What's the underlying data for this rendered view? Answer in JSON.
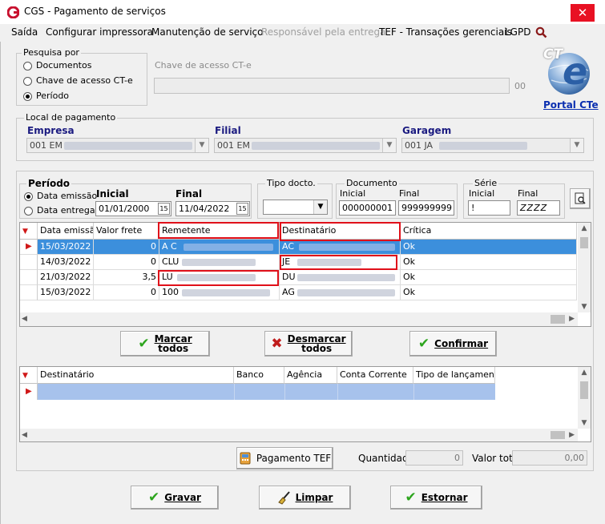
{
  "window": {
    "title": "CGS - Pagamento de serviços",
    "close": "✕"
  },
  "menu": {
    "items": [
      "Saída",
      "Configurar impressora",
      "Manutenção de serviço",
      "Responsável pela entrega",
      "TEF - Transações gerenciais",
      "LGPD"
    ],
    "disabled_item": "Responsável pela entrega"
  },
  "pesquisa": {
    "legend": "Pesquisa por",
    "options": [
      "Documentos",
      "Chave de acesso CT-e",
      "Período"
    ],
    "selected": "Período"
  },
  "chave": {
    "label": "Chave de acesso CT-e",
    "value": "",
    "suffix": "00"
  },
  "logo": {
    "text": "CT",
    "letter": "e",
    "link": "Portal CTe"
  },
  "local": {
    "legend": "Local de pagamento",
    "empresa_label": "Empresa",
    "empresa_value": "001 EM",
    "filial_label": "Filial",
    "filial_value": "001 EM",
    "garagem_label": "Garagem",
    "garagem_value": "001 JA"
  },
  "filters": {
    "periodo_legend": "Período",
    "periodo_options": [
      "Data emissão",
      "Data entrega"
    ],
    "periodo_selected": "Data emissão",
    "inicial_label": "Inicial",
    "inicial_value": "01/01/2000",
    "final_label": "Final",
    "final_value": "11/04/2022",
    "calendar_icon": "15",
    "tipo_legend": "Tipo docto.",
    "tipo_value": "",
    "documento_legend": "Documento",
    "doc_inicial_label": "Inicial",
    "doc_inicial_value": "000000001",
    "doc_final_label": "Final",
    "doc_final_value": "999999999",
    "serie_legend": "Série",
    "serie_inicial_label": "Inicial",
    "serie_inicial_value": "!",
    "serie_final_label": "Final",
    "serie_final_value": "ZZZZ"
  },
  "grid1": {
    "columns": [
      "Data emissão",
      "Valor frete",
      "Remetente",
      "Destinatário",
      "Crítica"
    ],
    "rows": [
      {
        "data": "15/03/2022",
        "valor": "0",
        "remetente": "A C",
        "destinatario": "AC",
        "critica": "Ok"
      },
      {
        "data": "14/03/2022",
        "valor": "0",
        "remetente": "CLU",
        "destinatario": "JE",
        "critica": "Ok"
      },
      {
        "data": "21/03/2022",
        "valor": "3,5",
        "remetente": "LU",
        "destinatario": "DU",
        "critica": "Ok"
      },
      {
        "data": "15/03/2022",
        "valor": "0",
        "remetente": "100",
        "destinatario": "AG",
        "critica": "Ok"
      }
    ]
  },
  "actions": {
    "marcar_1": "Marcar",
    "marcar_2": "todos",
    "desmarcar_1": "Desmarcar",
    "desmarcar_2": "todos",
    "confirmar": "Confirmar"
  },
  "grid2": {
    "columns": [
      "Destinatário",
      "Banco",
      "Agência",
      "Conta Corrente",
      "Tipo de lançamento"
    ]
  },
  "footer": {
    "pagamento_tef": "Pagamento TEF",
    "quantidade_label": "Quantidade",
    "quantidade_value": "0",
    "valor_total_label": "Valor total",
    "valor_total_value": "0,00"
  },
  "bottom": {
    "gravar": "Gravar",
    "limpar": "Limpar",
    "estornar": "Estornar"
  },
  "colors": {
    "accent": "#e81123",
    "selection": "#3c8fdc",
    "highlight": "#e0101a",
    "link": "#0b2fb0",
    "check": "#2da51e"
  }
}
